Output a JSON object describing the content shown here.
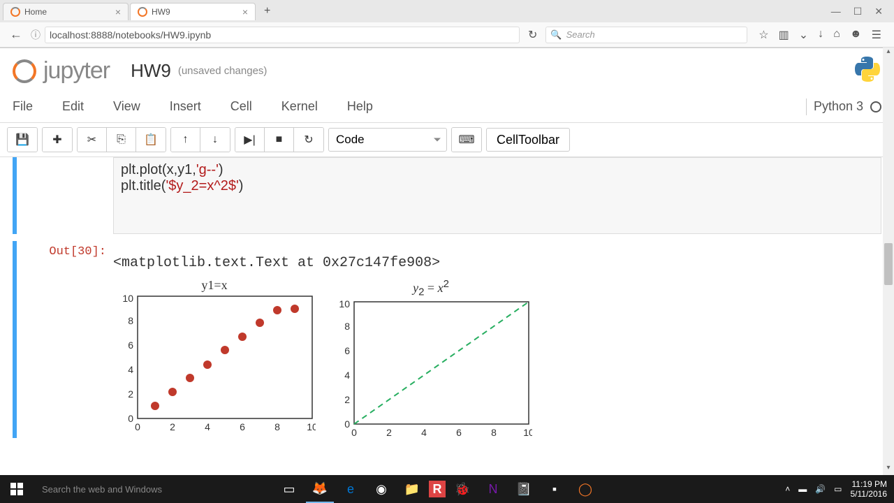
{
  "browser": {
    "tabs": [
      {
        "title": "Home",
        "active": false
      },
      {
        "title": "HW9",
        "active": true
      }
    ],
    "url": "localhost:8888/notebooks/HW9.ipynb",
    "search_placeholder": "Search"
  },
  "window_controls": {
    "min": "—",
    "max": "☐",
    "close": "✕"
  },
  "jupyter": {
    "logo_text": "jupyter",
    "notebook_name": "HW9",
    "status": "(unsaved changes)",
    "kernel_name": "Python 3"
  },
  "menubar": [
    "File",
    "Edit",
    "View",
    "Insert",
    "Cell",
    "Kernel",
    "Help"
  ],
  "toolbar": {
    "celltype": "Code",
    "celltoolbar": "CellToolbar"
  },
  "cell": {
    "code_line1_a": "plt.plot(x,y1,",
    "code_line1_b": "'g--'",
    "code_line1_c": ")",
    "code_line2_a": "plt.title(",
    "code_line2_b": "'$y_2=x^2$'",
    "code_line2_c": ")",
    "out_prompt": "Out[30]:",
    "out_text": "<matplotlib.text.Text at 0x27c147fe908>"
  },
  "chart_data": [
    {
      "type": "scatter",
      "title": "y1=x",
      "x": [
        1,
        2,
        3,
        4,
        5,
        6,
        7,
        8,
        9
      ],
      "y": [
        1,
        2.2,
        3.3,
        4.4,
        5.6,
        6.7,
        7.8,
        8.9,
        9.0
      ],
      "color": "#c0392b",
      "xlim": [
        0,
        10
      ],
      "ylim": [
        0,
        10
      ],
      "xticks": [
        0,
        2,
        4,
        6,
        8,
        10
      ],
      "yticks": [
        0,
        2,
        4,
        6,
        8,
        10
      ]
    },
    {
      "type": "line",
      "title": "y₂ = x²",
      "style": "dashed",
      "x": [
        0,
        10
      ],
      "y": [
        0,
        10
      ],
      "color": "#27ae60",
      "xlim": [
        0,
        10
      ],
      "ylim": [
        0,
        10
      ],
      "xticks": [
        0,
        2,
        4,
        6,
        8,
        10
      ],
      "yticks": [
        0,
        2,
        4,
        6,
        8,
        10
      ]
    }
  ],
  "taskbar": {
    "search_placeholder": "Search the web and Windows",
    "time": "11:19 PM",
    "date": "5/11/2016"
  }
}
